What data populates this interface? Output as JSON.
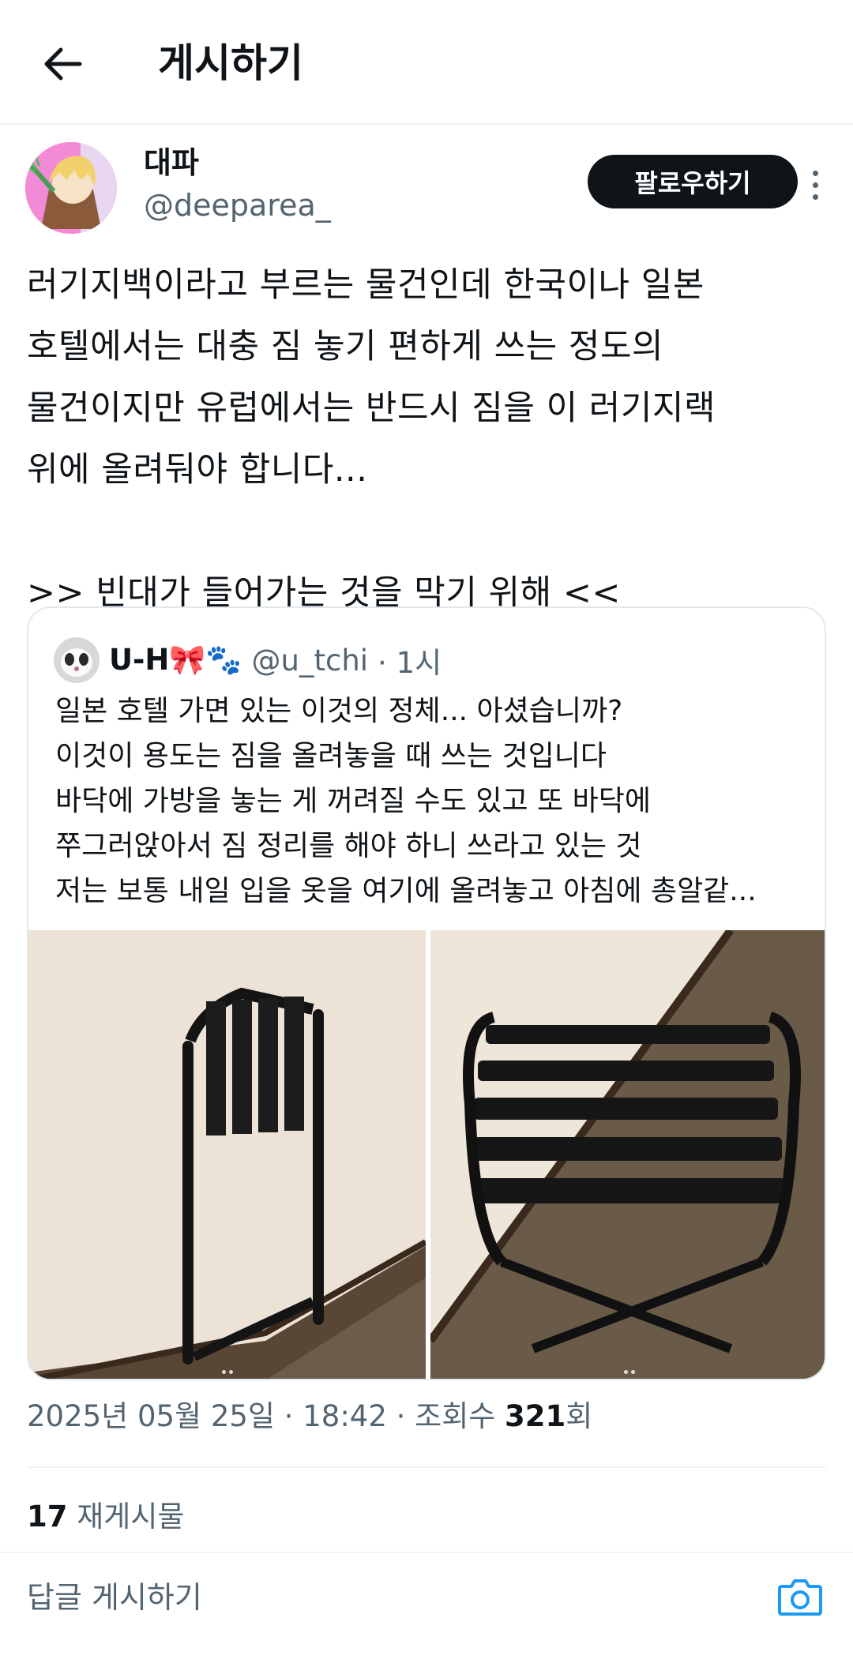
{
  "header": {
    "title": "게시하기"
  },
  "post": {
    "author": {
      "display_name": "대파",
      "handle": "@deeparea_"
    },
    "follow_label": "팔로우하기",
    "text": "러기지백이라고 부르는 물건인데 한국이나 일본\n호텔에서는 대충 짐 놓기 편하게 쓰는 정도의\n물건이지만 유럽에서는 반드시 짐을 이 러기지랙\n위에 올려둬야 합니다...\n\n>> 빈대가 들어가는 것을 막기 위해 <<",
    "quoted": {
      "author_name": "U-H🎀🐾",
      "handle": "@u_tchi",
      "time": "· 1시",
      "text": "일본 호텔 가면 있는 이것의 정체... 아셨습니까?\n이것이 용도는 짐을 올려놓을 때 쓰는 것입니다\n바닥에 가방을 놓는 게 꺼려질 수도 있고 또 바닥에\n쭈그러앉아서 짐 정리를 해야 하니 쓰라고 있는 것\n저는 보통 내일 입을 옷을 여기에 올려놓고 아침에 총알같..."
    },
    "meta": {
      "date_time": "2025년 05월 25일 · 18:42 · 조회수 ",
      "views": "321",
      "views_suffix": "회"
    },
    "reposts": {
      "count": "17",
      "label": " 재게시물"
    }
  },
  "reply": {
    "placeholder": "답글 게시하기"
  },
  "colors": {
    "primary_text": "#0f1419",
    "secondary_text": "#536471",
    "accent": "#1d9bf0",
    "divider": "#eff3f4"
  }
}
